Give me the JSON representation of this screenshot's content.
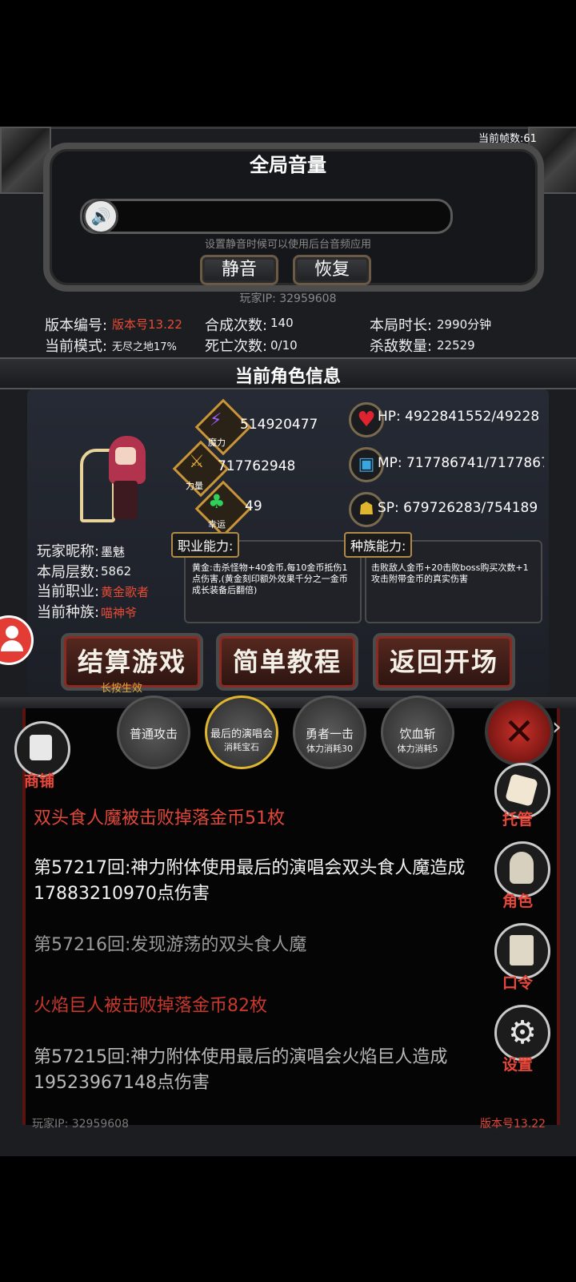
{
  "fps": "当前帧数:61",
  "volume": {
    "title": "全局音量",
    "hint": "设置静音时候可以使用后台音频应用",
    "mute_label": "静音",
    "restore_label": "恢复",
    "speaker_icon": "speaker-icon"
  },
  "player_ip_top": "玩家IP: 32959608",
  "game_info": {
    "version_label": "版本编号:",
    "version_value": "版本号13.22",
    "mode_label": "当前模式:",
    "mode_value": "无尽之地17%",
    "synth_label": "合成次数:",
    "synth_value": "140",
    "death_label": "死亡次数:",
    "death_value": "0/10",
    "duration_label": "本局时长:",
    "duration_value": "2990分钟",
    "kills_label": "杀敌数量:",
    "kills_value": "22529"
  },
  "char_section_title": "当前角色信息",
  "attributes": {
    "magic_label": "魔力",
    "magic_value": "514920477",
    "strength_label": "力量",
    "strength_value": "717762948",
    "luck_label": "幸运",
    "luck_value": "49"
  },
  "bars": {
    "hp": "HP: 4922841552/49228",
    "mp": "MP: 717786741/7177867",
    "sp": "SP: 679726283/754189"
  },
  "profile": {
    "nick_label": "玩家昵称:",
    "nick_value": "墨魅",
    "floor_label": "本局层数:",
    "floor_value": "5862",
    "job_label": "当前职业:",
    "job_value": "黄金歌者",
    "race_label": "当前种族:",
    "race_value": "喵神爷"
  },
  "abilities": {
    "job_title": "职业能力:",
    "job_text": "黄金:击杀怪物+40金币,每10金币抵伤1点伤害,(黄金刻印额外效果千分之一金币成长装备后翻倍)",
    "race_title": "种族能力:",
    "race_text": "击败敌人金币+20击败boss购买次数+1攻击附带金币的真实伤害"
  },
  "actions": {
    "settle": "结算游戏",
    "settle_hint": "长按生效",
    "tutorial": "简单教程",
    "back": "返回开场"
  },
  "skills": [
    {
      "name": "普通攻击",
      "cost": ""
    },
    {
      "name": "最后的演唱会",
      "cost": "消耗宝石"
    },
    {
      "name": "勇者一击",
      "cost": "体力消耗30"
    },
    {
      "name": "饮血斩",
      "cost": "体力消耗5"
    }
  ],
  "side": {
    "shop": "商铺",
    "auto": "托管",
    "role": "角色",
    "command": "口令",
    "settings": "设置"
  },
  "logs": [
    {
      "text": "双头食人魔被击败掉落金币51枚",
      "color": "#e0473a"
    },
    {
      "text": "第57217回:神力附体使用最后的演唱会双头食人魔造成17883210970点伤害",
      "color": "#f2f2f2"
    },
    {
      "text": "第57216回:发现游荡的双头食人魔",
      "color": "#9a9a9a"
    },
    {
      "text": "火焰巨人被击败掉落金币82枚",
      "color": "#c8382c"
    },
    {
      "text": "第57215回:神力附体使用最后的演唱会火焰巨人造成19523967148点伤害",
      "color": "#b9b9b9"
    }
  ],
  "footer": {
    "ip": "玩家IP: 32959608",
    "version": "版本号13.22"
  }
}
